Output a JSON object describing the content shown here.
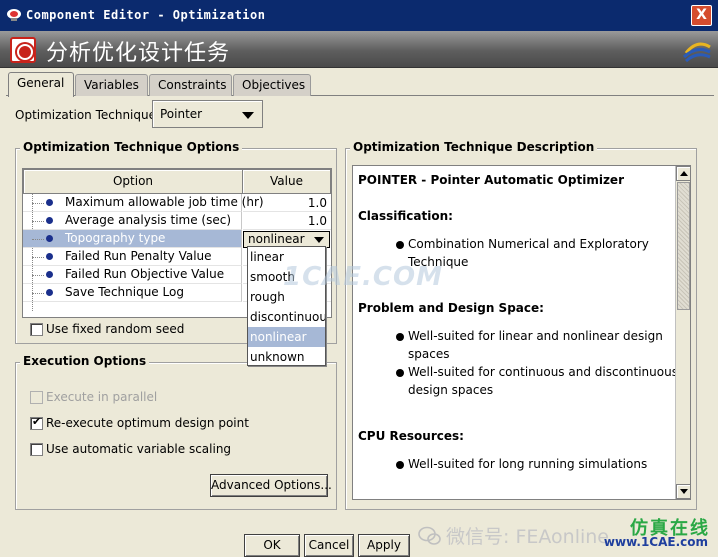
{
  "window": {
    "title": "Component Editor - Optimization",
    "close_label": "X"
  },
  "banner": {
    "title": "分析优化设计任务"
  },
  "tabs": [
    {
      "label": "General",
      "active": true
    },
    {
      "label": "Variables",
      "active": false
    },
    {
      "label": "Constraints",
      "active": false
    },
    {
      "label": "Objectives",
      "active": false
    }
  ],
  "technique": {
    "label": "Optimization Technique:",
    "selected": "Pointer"
  },
  "options_group": {
    "title": "Optimization Technique Options",
    "columns": [
      "Option",
      "Value"
    ],
    "rows": [
      {
        "name": "Maximum allowable job time (hr)",
        "value": "1.0"
      },
      {
        "name": "Average analysis time (sec)",
        "value": "1.0"
      },
      {
        "name": "Topography type",
        "value": "nonlinear",
        "selected": true
      },
      {
        "name": "Failed Run Penalty Value",
        "value": ""
      },
      {
        "name": "Failed Run Objective Value",
        "value": ""
      },
      {
        "name": "Save Technique Log",
        "value": ""
      }
    ],
    "dropdown_options": [
      "linear",
      "smooth",
      "rough",
      "discontinuous",
      "nonlinear",
      "unknown"
    ],
    "dropdown_selected": "nonlinear",
    "fixed_seed_label": "Use fixed random seed",
    "fixed_seed_checked": false
  },
  "execution_group": {
    "title": "Execution Options",
    "parallel_label": "Execute in parallel",
    "parallel_enabled": false,
    "reexecute_label": "Re-execute optimum design point",
    "reexecute_checked": true,
    "scaling_label": "Use automatic variable scaling",
    "scaling_checked": false,
    "advanced_button": "Advanced Options..."
  },
  "description": {
    "title": "Optimization Technique Description",
    "heading": "POINTER - Pointer Automatic Optimizer",
    "sections": [
      {
        "title": "Classification:",
        "bullets": [
          [
            "Combination Numerical and Exploratory",
            "Technique"
          ]
        ]
      },
      {
        "title": "Problem and Design Space:",
        "bullets": [
          [
            "Well-suited for linear and nonlinear design",
            "spaces"
          ],
          [
            "Well-suited for continuous and discontinuous",
            "design spaces"
          ]
        ]
      },
      {
        "title": "CPU Resources:",
        "bullets": [
          [
            "Well-suited for long running simulations"
          ]
        ]
      }
    ]
  },
  "buttons": {
    "ok": "OK",
    "cancel": "Cancel",
    "apply": "Apply"
  },
  "watermarks": {
    "center": "1CAE.COM",
    "wechat": "微信号: FEAonline",
    "site_cn": "仿真在线",
    "site_url": "www.1CAE.com"
  },
  "colors": {
    "titlebar": "#0b2a6e",
    "selection": "#a6b8d6",
    "bullet": "#1a2f8c",
    "site_green": "#2aa845"
  }
}
